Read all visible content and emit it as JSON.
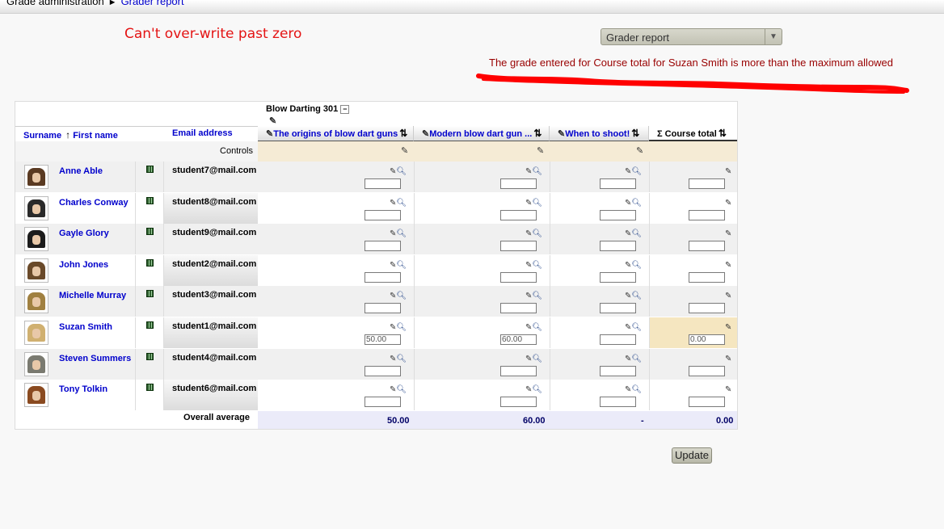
{
  "breadcrumb": {
    "first": "Grade administration",
    "separator": "►",
    "current": "Grader report"
  },
  "annotation": "Can't over-write past zero",
  "report_select": {
    "value": "Grader report"
  },
  "error_message": "The grade entered for Course total for Suzan Smith is more than the maximum allowed",
  "table": {
    "category": "Blow Darting 301",
    "headers": {
      "surname": "Surname",
      "firstname": "First name",
      "email": "Email address",
      "col1": "The origins of blow dart guns",
      "col2": "Modern blow dart gun ...",
      "col3": "When to shoot!",
      "total": "Course total",
      "sigma": "Σ"
    },
    "controls_label": "Controls",
    "students": [
      {
        "name": "Anne Able",
        "email": "student7@mail.com",
        "g1": "",
        "g2": "",
        "g3": "",
        "total": ""
      },
      {
        "name": "Charles Conway",
        "email": "student8@mail.com",
        "g1": "",
        "g2": "",
        "g3": "",
        "total": ""
      },
      {
        "name": "Gayle Glory",
        "email": "student9@mail.com",
        "g1": "",
        "g2": "",
        "g3": "",
        "total": ""
      },
      {
        "name": "John Jones",
        "email": "student2@mail.com",
        "g1": "",
        "g2": "",
        "g3": "",
        "total": ""
      },
      {
        "name": "Michelle Murray",
        "email": "student3@mail.com",
        "g1": "",
        "g2": "",
        "g3": "",
        "total": ""
      },
      {
        "name": "Suzan Smith",
        "email": "student1@mail.com",
        "g1": "50.00",
        "g2": "60.00",
        "g3": "",
        "total": "0.00"
      },
      {
        "name": "Steven Summers",
        "email": "student4@mail.com",
        "g1": "",
        "g2": "",
        "g3": "",
        "total": ""
      },
      {
        "name": "Tony Tolkin",
        "email": "student6@mail.com",
        "g1": "",
        "g2": "",
        "g3": "",
        "total": ""
      }
    ],
    "overall_label": "Overall average",
    "averages": {
      "col1": "50.00",
      "col2": "60.00",
      "col3": "-",
      "total": "0.00"
    }
  },
  "update_button": "Update",
  "colors": {
    "annotation": "#e41414",
    "error": "#990000",
    "link": "#0000cc",
    "highlight": "#f5e6c0"
  },
  "icons": [
    "edit-icon",
    "search-icon",
    "sort-icon",
    "collapse-icon",
    "spreadsheet-icon",
    "sigma-icon"
  ]
}
